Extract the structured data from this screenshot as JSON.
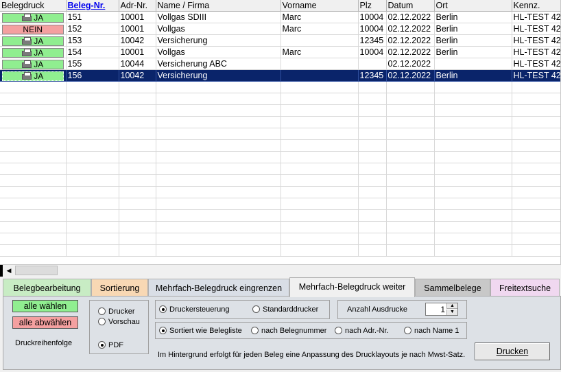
{
  "grid": {
    "columns": [
      "Belegdruck",
      "Beleg-Nr.",
      "Adr-Nr.",
      "Name / Firma",
      "Vorname",
      "Plz",
      "Datum",
      "Ort",
      "Kennz."
    ],
    "rows": [
      {
        "druck": "JA",
        "beleg": "151",
        "adr": "10001",
        "name": "Vollgas SDIII",
        "vorname": "Marc",
        "plz": "10004",
        "datum": "02.12.2022",
        "ort": "Berlin",
        "kennz": "HL-TEST 42"
      },
      {
        "druck": "NEIN",
        "beleg": "152",
        "adr": "10001",
        "name": "Vollgas",
        "vorname": "Marc",
        "plz": "10004",
        "datum": "02.12.2022",
        "ort": "Berlin",
        "kennz": "HL-TEST 42"
      },
      {
        "druck": "JA",
        "beleg": "153",
        "adr": "10042",
        "name": "Versicherung",
        "vorname": "",
        "plz": "12345",
        "datum": "02.12.2022",
        "ort": "Berlin",
        "kennz": "HL-TEST 42"
      },
      {
        "druck": "JA",
        "beleg": "154",
        "adr": "10001",
        "name": "Vollgas",
        "vorname": "Marc",
        "plz": "10004",
        "datum": "02.12.2022",
        "ort": "Berlin",
        "kennz": "HL-TEST 42"
      },
      {
        "druck": "JA",
        "beleg": "155",
        "adr": "10044",
        "name": "Versicherung ABC",
        "vorname": "",
        "plz": "",
        "datum": "02.12.2022",
        "ort": "",
        "kennz": "HL-TEST 42"
      },
      {
        "druck": "JA",
        "beleg": "156",
        "adr": "10042",
        "name": "Versicherung",
        "vorname": "",
        "plz": "12345",
        "datum": "02.12.2022",
        "ort": "Berlin",
        "kennz": "HL-TEST 42"
      }
    ],
    "selected_row": 5
  },
  "tabs": [
    {
      "label": "Belegbearbeitung",
      "color": "#c8ecc4"
    },
    {
      "label": "Sortierung",
      "color": "#f8d8b4"
    },
    {
      "label": "Mehrfach-Belegdruck eingrenzen",
      "color": "#d9dee6"
    },
    {
      "label": "Mehrfach-Belegdruck weiter",
      "color": "#f0f0f0"
    },
    {
      "label": "Sammelbelege",
      "color": "#c8c8c8"
    },
    {
      "label": "Freitextsuche",
      "color": "#f0d8f0"
    }
  ],
  "active_tab": 3,
  "panel": {
    "select_all": "alle wählen",
    "deselect_all": "alle abwählen",
    "print_order_label": "Druckreihenfolge",
    "output": {
      "drucker": "Drucker",
      "vorschau": "Vorschau",
      "pdf": "PDF",
      "selected": "PDF"
    },
    "control": {
      "druckersteuerung": "Druckersteuerung",
      "standarddrucker": "Standarddrucker",
      "selected": "Druckersteuerung"
    },
    "copies_label": "Anzahl Ausdrucke",
    "copies_value": "1",
    "sort": {
      "wie_liste": "Sortiert wie Belegliste",
      "nach_belegnummer": "nach Belegnummer",
      "nach_adr": "nach Adr.-Nr.",
      "nach_name": "nach Name 1",
      "selected": "Sortiert wie Belegliste"
    },
    "info": "Im Hintergrund erfolgt für jeden Beleg eine Anpassung des Drucklayouts je nach Mwst-Satz.",
    "print_button": "Drucken"
  }
}
